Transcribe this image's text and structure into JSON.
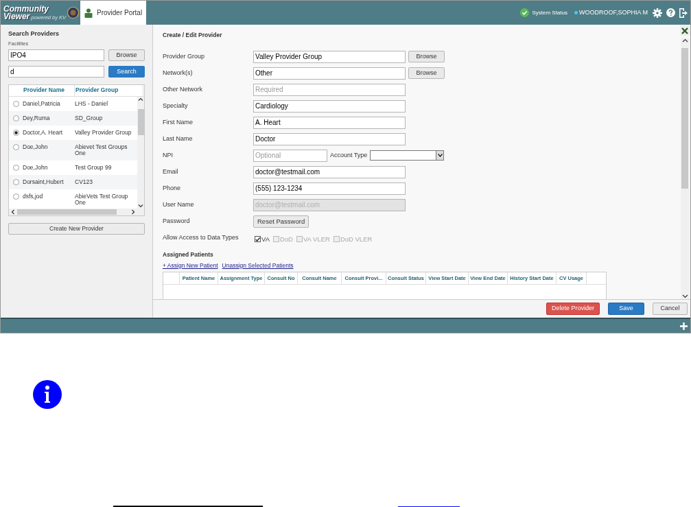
{
  "header": {
    "logo": {
      "line1": "Community",
      "line2": "Viewer",
      "tagline": "powered by KV"
    },
    "tabs": [
      {
        "label": "Provider Portal",
        "selected": true
      }
    ],
    "system_status": "System Status",
    "user": "WOODROOF,SOPHIA M"
  },
  "search_panel": {
    "title": "Search Providers",
    "facilities_label": "Facilities",
    "facility_value": "IPO4",
    "browse_button": "Browse",
    "search_value": "d",
    "search_button": "Search",
    "columns": [
      "Provider Name",
      "Provider Group"
    ],
    "rows": [
      {
        "name": "Daniel,Patricia",
        "group": "LHS - Daniel",
        "selected": false
      },
      {
        "name": "Dey,Ruma",
        "group": "SD_Group",
        "selected": false
      },
      {
        "name": "Doctor,A. Heart",
        "group": "Valley Provider Group",
        "selected": true
      },
      {
        "name": "Doe,John",
        "group": "Abievet Test Groups One",
        "selected": false
      },
      {
        "name": "Doe,John",
        "group": "Test Group 99",
        "selected": false
      },
      {
        "name": "Dorsaint,Hubert",
        "group": "CV123",
        "selected": false
      },
      {
        "name": "dsfs,jod",
        "group": "AbieVets Test Group One",
        "selected": false
      }
    ],
    "create_button": "Create New Provider"
  },
  "form": {
    "title": "Create / Edit Provider",
    "fields": [
      {
        "kind": "input",
        "label": "Provider Group",
        "value": "Valley Provider Group",
        "button": "Browse",
        "disabled": false
      },
      {
        "kind": "input",
        "label": "Network(s)",
        "value": "Other",
        "button": "Browse",
        "disabled": false
      },
      {
        "kind": "input",
        "label": "Other Network",
        "placeholder": "Required",
        "disabled": false
      },
      {
        "kind": "input",
        "label": "Specialty",
        "value": "Cardiology",
        "disabled": false
      },
      {
        "kind": "input",
        "label": "First Name",
        "value": "A. Heart",
        "disabled": false
      },
      {
        "kind": "input",
        "label": "Last Name",
        "value": "Doctor",
        "disabled": false
      },
      {
        "kind": "npi",
        "label": "NPI",
        "placeholder": "Optional",
        "select_label": "Account Type"
      },
      {
        "kind": "input",
        "label": "Email",
        "value": "doctor@testmail.com",
        "disabled": false
      },
      {
        "kind": "input",
        "label": "Phone",
        "value": "(555) 123-1234",
        "disabled": false
      },
      {
        "kind": "input",
        "label": "User Name",
        "value": "doctor@testmail.com",
        "disabled": true
      },
      {
        "kind": "button",
        "label": "Password",
        "button": "Reset Password"
      },
      {
        "kind": "checks",
        "label": "Allow Access to Data Types",
        "options": [
          {
            "label": "VA",
            "checked": true,
            "disabled": false
          },
          {
            "label": "DoD",
            "checked": false,
            "disabled": true
          },
          {
            "label": "VA VLER",
            "checked": false,
            "disabled": true
          },
          {
            "label": "DoD VLER",
            "checked": false,
            "disabled": true
          }
        ]
      }
    ]
  },
  "assigned_patients": {
    "title": "Assigned Patients",
    "links": [
      "+ Assign New Patient",
      "Unassign Selected Patients"
    ],
    "columns": [
      "Patient Name",
      "Assignment Type",
      "Consult No",
      "Consult Name",
      "Consult Provi...",
      "Consult Status",
      "View Start Date",
      "View End Date",
      "History Start Date",
      "CV Usage"
    ]
  },
  "actions": [
    {
      "kind": "danger",
      "label": "Delete Provider"
    },
    {
      "kind": "primary",
      "label": "Save"
    },
    {
      "kind": "default",
      "label": "Cancel"
    }
  ]
}
